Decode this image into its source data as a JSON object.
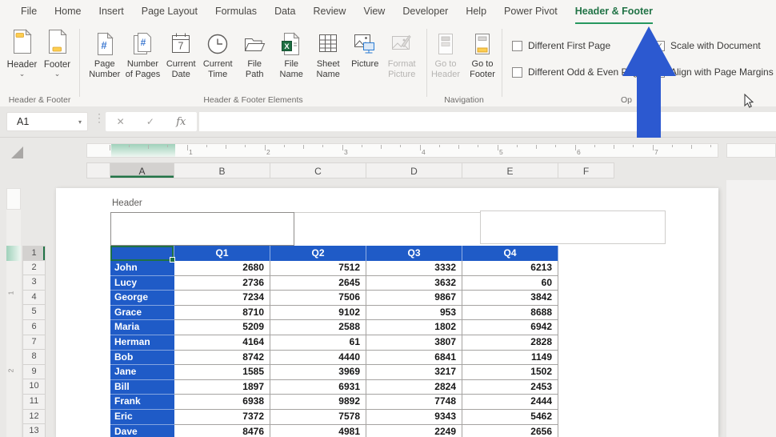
{
  "menu": {
    "tabs": [
      "File",
      "Home",
      "Insert",
      "Page Layout",
      "Formulas",
      "Data",
      "Review",
      "View",
      "Developer",
      "Help",
      "Power Pivot",
      "Header & Footer"
    ],
    "active_tab": "Header & Footer"
  },
  "ribbon": {
    "header_footer": {
      "label": "Header & Footer",
      "dropdown_chevron": "⌄",
      "buttons": [
        {
          "label": "Header",
          "icon": "header-doc"
        },
        {
          "label": "Footer",
          "icon": "footer-doc"
        }
      ]
    },
    "elements": {
      "label": "Header & Footer Elements",
      "buttons": [
        {
          "label": "Page Number",
          "lines": [
            "Page",
            "Number"
          ],
          "icon": "page-number",
          "disabled": false
        },
        {
          "label": "Number of Pages",
          "lines": [
            "Number",
            "of Pages"
          ],
          "icon": "number-of-pages",
          "disabled": false
        },
        {
          "label": "Current Date",
          "lines": [
            "Current",
            "Date"
          ],
          "icon": "calendar",
          "disabled": false
        },
        {
          "label": "Current Time",
          "lines": [
            "Current",
            "Time"
          ],
          "icon": "clock",
          "disabled": false
        },
        {
          "label": "File Path",
          "lines": [
            "File",
            "Path"
          ],
          "icon": "file-path",
          "disabled": false
        },
        {
          "label": "File Name",
          "lines": [
            "File",
            "Name"
          ],
          "icon": "file-name",
          "disabled": false
        },
        {
          "label": "Sheet Name",
          "lines": [
            "Sheet",
            "Name"
          ],
          "icon": "sheet-name",
          "disabled": false
        },
        {
          "label": "Picture",
          "lines": [
            "Picture"
          ],
          "icon": "picture",
          "disabled": false
        },
        {
          "label": "Format Picture",
          "lines": [
            "Format",
            "Picture"
          ],
          "icon": "format-picture",
          "disabled": true
        }
      ]
    },
    "navigation": {
      "label": "Navigation",
      "buttons": [
        {
          "label": "Go to Header",
          "lines": [
            "Go to",
            "Header"
          ],
          "icon": "goto-header",
          "disabled": true
        },
        {
          "label": "Go to Footer",
          "lines": [
            "Go to",
            "Footer"
          ],
          "icon": "goto-footer",
          "disabled": false
        }
      ]
    },
    "options": {
      "label": "Op",
      "checkboxes": [
        {
          "label": "Different First Page",
          "checked": false
        },
        {
          "label": "Different Odd & Even Pag",
          "checked": false
        },
        {
          "label": "Scale with Document",
          "checked": true
        },
        {
          "label": "Align with Page Margins",
          "checked": true
        }
      ]
    }
  },
  "formula_bar": {
    "name_box": "A1",
    "formula": "",
    "icons": {
      "caret": "▾",
      "dots": "⋮",
      "cancel": "✕",
      "enter": "✓",
      "function": "fx"
    }
  },
  "sheet": {
    "header_label": "Header",
    "ruler": {
      "h_numbers": [
        "1",
        "2",
        "3",
        "4",
        "5",
        "6",
        "7"
      ],
      "v_numbers": [
        "1",
        "2"
      ]
    },
    "column_headers": [
      "A",
      "B",
      "C",
      "D",
      "E",
      "F"
    ],
    "selected_column": "A",
    "row_numbers": [
      "1",
      "2",
      "3",
      "4",
      "5",
      "6",
      "7",
      "8",
      "9",
      "10",
      "11",
      "12",
      "13"
    ],
    "selected_row": "1",
    "selection": {
      "cell": "A1"
    },
    "table": {
      "columns": [
        "",
        "Q1",
        "Q2",
        "Q3",
        "Q4"
      ],
      "rows": [
        {
          "name": "John",
          "values": [
            2680,
            7512,
            3332,
            6213
          ]
        },
        {
          "name": "Lucy",
          "values": [
            2736,
            2645,
            3632,
            60
          ]
        },
        {
          "name": "George",
          "values": [
            7234,
            7506,
            9867,
            3842
          ]
        },
        {
          "name": "Grace",
          "values": [
            8710,
            9102,
            953,
            8688
          ]
        },
        {
          "name": "Maria",
          "values": [
            5209,
            2588,
            1802,
            6942
          ]
        },
        {
          "name": "Herman",
          "values": [
            4164,
            61,
            3807,
            2828
          ]
        },
        {
          "name": "Bob",
          "values": [
            8742,
            4440,
            6841,
            1149
          ]
        },
        {
          "name": "Jane",
          "values": [
            1585,
            3969,
            3217,
            1502
          ]
        },
        {
          "name": "Bill",
          "values": [
            1897,
            6931,
            2824,
            2453
          ]
        },
        {
          "name": "Frank",
          "values": [
            6938,
            9892,
            7748,
            2444
          ]
        },
        {
          "name": "Eric",
          "values": [
            7372,
            7578,
            9343,
            5462
          ]
        },
        {
          "name": "Dave",
          "values": [
            8476,
            4981,
            2249,
            2656
          ]
        }
      ]
    }
  },
  "colors": {
    "accent_green": "#217346",
    "tab_underline_green": "#27985f",
    "table_blue": "#1f5bc7",
    "arrow_blue": "#2c59d0",
    "icon_yellow": "#fccd51",
    "selection_green": "#1e7145"
  }
}
